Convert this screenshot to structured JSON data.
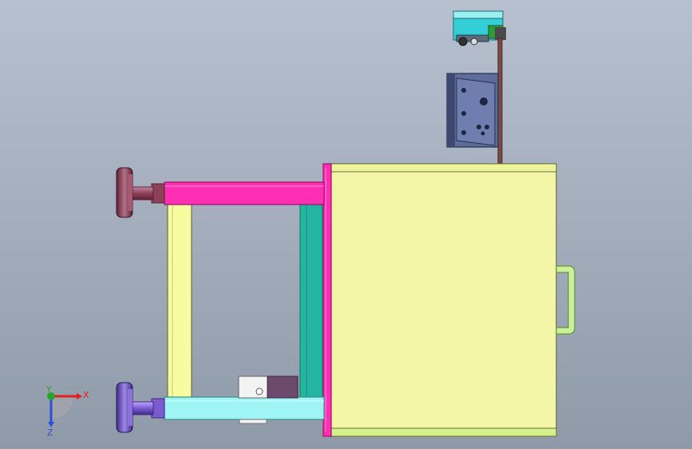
{
  "viewport": {
    "background": {
      "top": "#b7c0cf",
      "bottom": "#8f9aa9"
    }
  },
  "model": {
    "colors": {
      "frame_yellow": "#f6fb9f",
      "frame_yellow_edge": "#6e7040",
      "box_body": "#f3f6a6",
      "box_body_edge": "#6e7040",
      "box_edge_light": "#e6f29c",
      "box_bottom_strip": "#d6f08a",
      "magenta": "#ff2fb4",
      "magenta_edge": "#a00f6a",
      "magenta_dark": "#c8157f",
      "teal": "#23b5a0",
      "teal_dark": "#15806f",
      "cyan_bar": "#9ff4f4",
      "cyan_edge": "#3b8d8d",
      "foot_maroon": "#8c4159",
      "foot_maroon_dark": "#5d2136",
      "foot_purple": "#7a5bd0",
      "foot_purple_dark": "#3f2a86",
      "handle_green": "#c9f296",
      "handle_edge": "#6f8f49",
      "rod_brown": "#7a4a45",
      "panel_slate": "#5e6c9a",
      "panel_slate_dark": "#3d4770",
      "block_purple": "#6b4a6d",
      "block_white": "#f3f3f3",
      "sensor_cyan": "#34cfd6",
      "sensor_green": "#2e9a3a"
    }
  },
  "triad": {
    "x_label": "X",
    "y_label": "Y",
    "z_label": "Z",
    "x_color": "#e41d1d",
    "y_color": "#27a52b",
    "z_color": "#2e4fd8"
  }
}
